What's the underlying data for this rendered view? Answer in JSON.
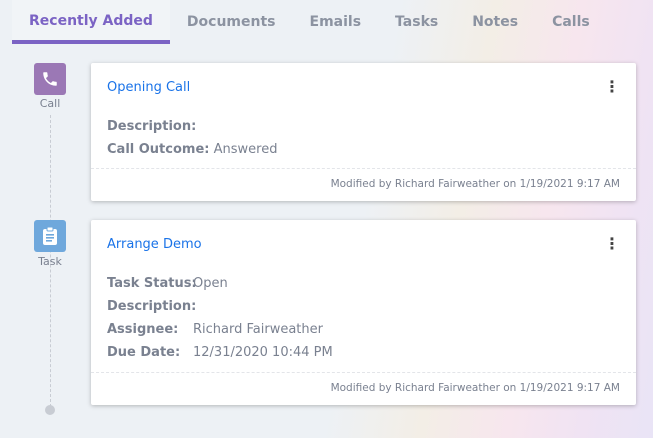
{
  "tabs": [
    "Recently Added",
    "Documents",
    "Emails",
    "Tasks",
    "Notes",
    "Calls"
  ],
  "items": [
    {
      "type": "Call",
      "icon": "phone-icon",
      "color": "#9b78b5",
      "title": "Opening Call",
      "fields": [
        {
          "label": "Description:",
          "value": ""
        },
        {
          "label": "Call Outcome:",
          "value": "Answered"
        }
      ],
      "footer": "Modified by Richard Fairweather on 1/19/2021 9:17 AM"
    },
    {
      "type": "Task",
      "icon": "clipboard-icon",
      "color": "#6fa8dc",
      "title": "Arrange Demo",
      "fields": [
        {
          "label": "Task Status:",
          "value": "Open"
        },
        {
          "label": "Description:",
          "value": ""
        },
        {
          "label": "Assignee:",
          "value": "Richard Fairweather"
        },
        {
          "label": "Due Date:",
          "value": "12/31/2020 10:44 PM"
        }
      ],
      "footer": "Modified by Richard Fairweather on 1/19/2021 9:17 AM"
    }
  ],
  "menu_glyph": "⋮"
}
